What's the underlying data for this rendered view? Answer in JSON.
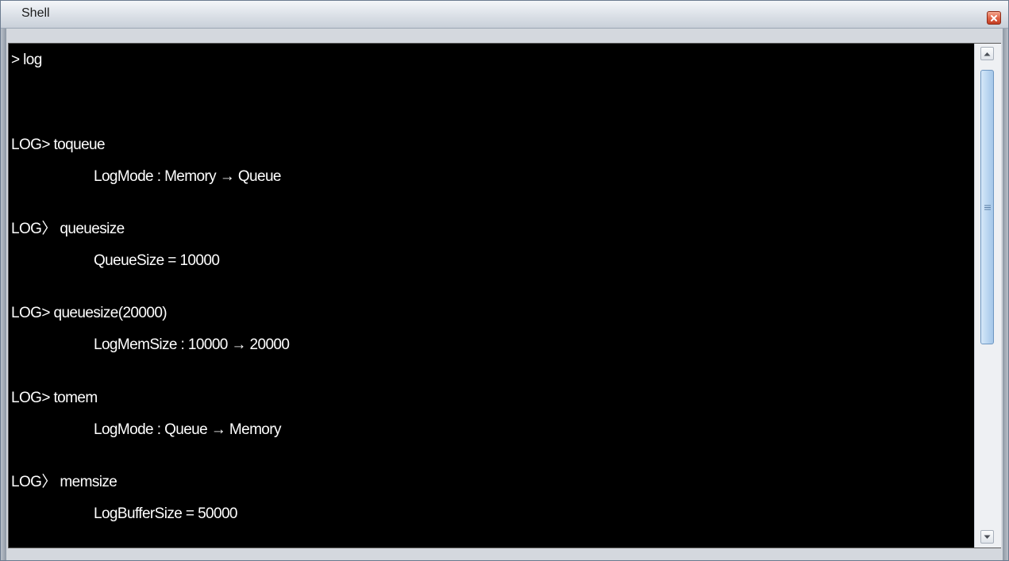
{
  "window": {
    "title": "Shell",
    "close_icon": "close-icon"
  },
  "console": {
    "lines": [
      "> log",
      "LOG> toqueue",
      "LogMode : Memory → Queue",
      "LOG〉 queuesize",
      "QueueSize = 10000",
      "LOG> queuesize(20000)",
      "LogMemSize : 10000 → 20000",
      "LOG> tomem",
      "LogMode : Queue → Memory",
      "LOG〉 memsize",
      "LogBufferSize = 50000"
    ]
  },
  "scrollbar": {
    "up_icon": "scroll-up-arrow-icon",
    "down_icon": "scroll-down-arrow-icon",
    "thumb_grip_icon": "grip-icon"
  },
  "colors": {
    "console_background": "#000000",
    "console_text": "#ffffff",
    "close_button": "#d9543a",
    "scroll_thumb": "#bcd7f1"
  }
}
